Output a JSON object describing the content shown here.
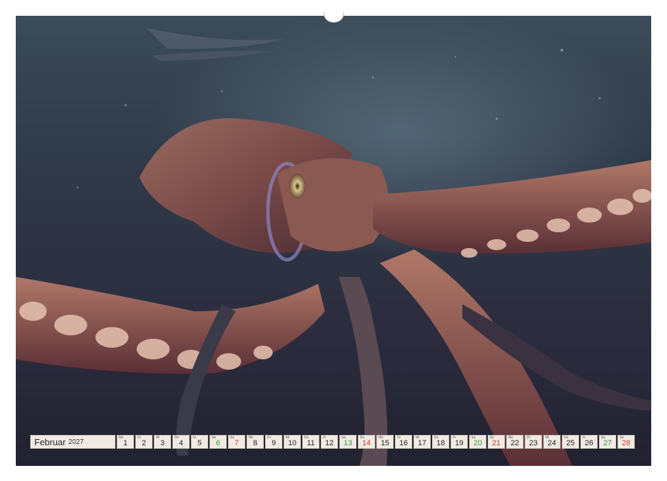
{
  "calendar": {
    "month": "Februar",
    "year": "2027",
    "days": [
      {
        "wd": "Mo",
        "d": "1",
        "kind": "weekday"
      },
      {
        "wd": "Di",
        "d": "2",
        "kind": "weekday"
      },
      {
        "wd": "Mi",
        "d": "3",
        "kind": "weekday"
      },
      {
        "wd": "Do",
        "d": "4",
        "kind": "weekday"
      },
      {
        "wd": "Fr",
        "d": "5",
        "kind": "weekday"
      },
      {
        "wd": "Sa",
        "d": "6",
        "kind": "sat"
      },
      {
        "wd": "So",
        "d": "7",
        "kind": "sun"
      },
      {
        "wd": "Mo",
        "d": "8",
        "kind": "weekday"
      },
      {
        "wd": "Di",
        "d": "9",
        "kind": "weekday"
      },
      {
        "wd": "Mi",
        "d": "10",
        "kind": "weekday"
      },
      {
        "wd": "Do",
        "d": "11",
        "kind": "weekday"
      },
      {
        "wd": "Fr",
        "d": "12",
        "kind": "weekday"
      },
      {
        "wd": "Sa",
        "d": "13",
        "kind": "sat"
      },
      {
        "wd": "So",
        "d": "14",
        "kind": "sun"
      },
      {
        "wd": "Mo",
        "d": "15",
        "kind": "weekday"
      },
      {
        "wd": "Di",
        "d": "16",
        "kind": "weekday"
      },
      {
        "wd": "Mi",
        "d": "17",
        "kind": "weekday"
      },
      {
        "wd": "Do",
        "d": "18",
        "kind": "weekday"
      },
      {
        "wd": "Fr",
        "d": "19",
        "kind": "weekday"
      },
      {
        "wd": "Sa",
        "d": "20",
        "kind": "sat"
      },
      {
        "wd": "So",
        "d": "21",
        "kind": "sun"
      },
      {
        "wd": "Mo",
        "d": "22",
        "kind": "weekday"
      },
      {
        "wd": "Di",
        "d": "23",
        "kind": "weekday"
      },
      {
        "wd": "Mi",
        "d": "24",
        "kind": "weekday"
      },
      {
        "wd": "Do",
        "d": "25",
        "kind": "weekday"
      },
      {
        "wd": "Fr",
        "d": "26",
        "kind": "weekday"
      },
      {
        "wd": "Sa",
        "d": "27",
        "kind": "sat"
      },
      {
        "wd": "So",
        "d": "28",
        "kind": "sun"
      }
    ]
  },
  "colors": {
    "saturday": "#2f9a3a",
    "sunday": "#d23a2a",
    "cell_background": "#f1ebe4"
  }
}
